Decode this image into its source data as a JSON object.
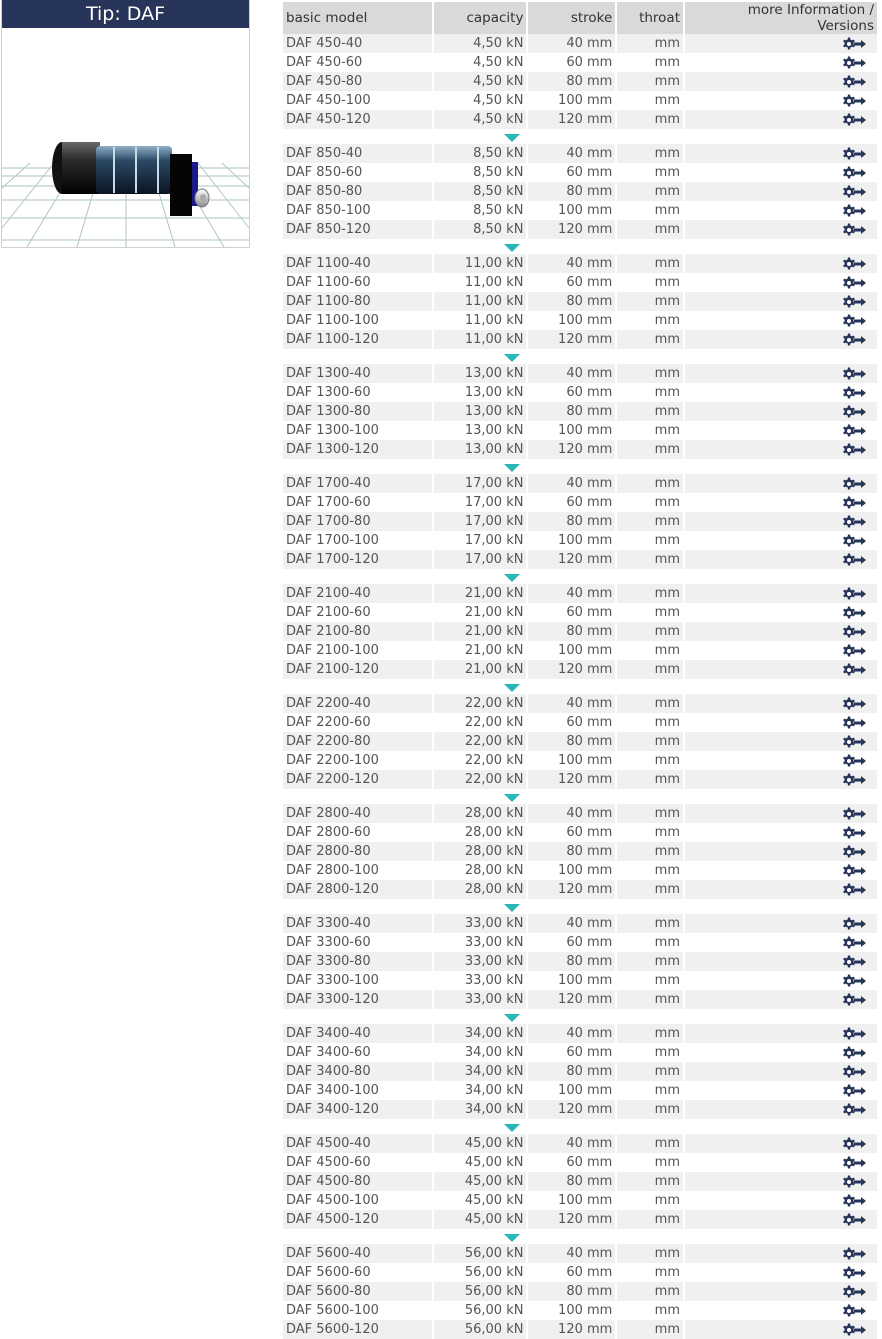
{
  "tip": {
    "title": "Tip: DAF"
  },
  "table": {
    "headers": {
      "model": "basic model",
      "capacity": "capacity",
      "stroke": "stroke",
      "throat": "throat",
      "info": "more Information / Versions"
    },
    "strokes": [
      "40 mm",
      "60 mm",
      "80 mm",
      "100 mm",
      "120 mm"
    ],
    "throat": "mm",
    "groups": [
      {
        "rows": [
          {
            "model": "DAF 450-40",
            "capacity": "4,50 kN"
          },
          {
            "model": "DAF 450-60",
            "capacity": "4,50 kN"
          },
          {
            "model": "DAF 450-80",
            "capacity": "4,50 kN"
          },
          {
            "model": "DAF 450-100",
            "capacity": "4,50 kN"
          },
          {
            "model": "DAF 450-120",
            "capacity": "4,50 kN"
          }
        ]
      },
      {
        "rows": [
          {
            "model": "DAF 850-40",
            "capacity": "8,50 kN"
          },
          {
            "model": "DAF 850-60",
            "capacity": "8,50 kN"
          },
          {
            "model": "DAF 850-80",
            "capacity": "8,50 kN"
          },
          {
            "model": "DAF 850-100",
            "capacity": "8,50 kN"
          },
          {
            "model": "DAF 850-120",
            "capacity": "8,50 kN"
          }
        ]
      },
      {
        "rows": [
          {
            "model": "DAF 1100-40",
            "capacity": "11,00 kN"
          },
          {
            "model": "DAF 1100-60",
            "capacity": "11,00 kN"
          },
          {
            "model": "DAF 1100-80",
            "capacity": "11,00 kN"
          },
          {
            "model": "DAF 1100-100",
            "capacity": "11,00 kN"
          },
          {
            "model": "DAF 1100-120",
            "capacity": "11,00 kN"
          }
        ]
      },
      {
        "rows": [
          {
            "model": "DAF 1300-40",
            "capacity": "13,00 kN"
          },
          {
            "model": "DAF 1300-60",
            "capacity": "13,00 kN"
          },
          {
            "model": "DAF 1300-80",
            "capacity": "13,00 kN"
          },
          {
            "model": "DAF 1300-100",
            "capacity": "13,00 kN"
          },
          {
            "model": "DAF 1300-120",
            "capacity": "13,00 kN"
          }
        ]
      },
      {
        "rows": [
          {
            "model": "DAF 1700-40",
            "capacity": "17,00 kN"
          },
          {
            "model": "DAF 1700-60",
            "capacity": "17,00 kN"
          },
          {
            "model": "DAF 1700-80",
            "capacity": "17,00 kN"
          },
          {
            "model": "DAF 1700-100",
            "capacity": "17,00 kN"
          },
          {
            "model": "DAF 1700-120",
            "capacity": "17,00 kN"
          }
        ]
      },
      {
        "rows": [
          {
            "model": "DAF 2100-40",
            "capacity": "21,00 kN"
          },
          {
            "model": "DAF 2100-60",
            "capacity": "21,00 kN"
          },
          {
            "model": "DAF 2100-80",
            "capacity": "21,00 kN"
          },
          {
            "model": "DAF 2100-100",
            "capacity": "21,00 kN"
          },
          {
            "model": "DAF 2100-120",
            "capacity": "21,00 kN"
          }
        ]
      },
      {
        "rows": [
          {
            "model": "DAF 2200-40",
            "capacity": "22,00 kN"
          },
          {
            "model": "DAF 2200-60",
            "capacity": "22,00 kN"
          },
          {
            "model": "DAF 2200-80",
            "capacity": "22,00 kN"
          },
          {
            "model": "DAF 2200-100",
            "capacity": "22,00 kN"
          },
          {
            "model": "DAF 2200-120",
            "capacity": "22,00 kN"
          }
        ]
      },
      {
        "rows": [
          {
            "model": "DAF 2800-40",
            "capacity": "28,00 kN"
          },
          {
            "model": "DAF 2800-60",
            "capacity": "28,00 kN"
          },
          {
            "model": "DAF 2800-80",
            "capacity": "28,00 kN"
          },
          {
            "model": "DAF 2800-100",
            "capacity": "28,00 kN"
          },
          {
            "model": "DAF 2800-120",
            "capacity": "28,00 kN"
          }
        ]
      },
      {
        "rows": [
          {
            "model": "DAF 3300-40",
            "capacity": "33,00 kN"
          },
          {
            "model": "DAF 3300-60",
            "capacity": "33,00 kN"
          },
          {
            "model": "DAF 3300-80",
            "capacity": "33,00 kN"
          },
          {
            "model": "DAF 3300-100",
            "capacity": "33,00 kN"
          },
          {
            "model": "DAF 3300-120",
            "capacity": "33,00 kN"
          }
        ]
      },
      {
        "rows": [
          {
            "model": "DAF 3400-40",
            "capacity": "34,00 kN"
          },
          {
            "model": "DAF 3400-60",
            "capacity": "34,00 kN"
          },
          {
            "model": "DAF 3400-80",
            "capacity": "34,00 kN"
          },
          {
            "model": "DAF 3400-100",
            "capacity": "34,00 kN"
          },
          {
            "model": "DAF 3400-120",
            "capacity": "34,00 kN"
          }
        ]
      },
      {
        "rows": [
          {
            "model": "DAF 4500-40",
            "capacity": "45,00 kN"
          },
          {
            "model": "DAF 4500-60",
            "capacity": "45,00 kN"
          },
          {
            "model": "DAF 4500-80",
            "capacity": "45,00 kN"
          },
          {
            "model": "DAF 4500-100",
            "capacity": "45,00 kN"
          },
          {
            "model": "DAF 4500-120",
            "capacity": "45,00 kN"
          }
        ]
      },
      {
        "rows": [
          {
            "model": "DAF 5600-40",
            "capacity": "56,00 kN"
          },
          {
            "model": "DAF 5600-60",
            "capacity": "56,00 kN"
          },
          {
            "model": "DAF 5600-80",
            "capacity": "56,00 kN"
          },
          {
            "model": "DAF 5600-100",
            "capacity": "56,00 kN"
          },
          {
            "model": "DAF 5600-120",
            "capacity": "56,00 kN"
          }
        ]
      }
    ]
  },
  "icons": {
    "row_action": "gear-arrow-icon",
    "group_separator": "triangle-down-icon"
  },
  "colors": {
    "title_bg": "#27355a",
    "header_bg": "#d9d9d9",
    "stripe": "#f0f0f0",
    "accent": "#2ab7b7",
    "icon": "#27355a"
  }
}
